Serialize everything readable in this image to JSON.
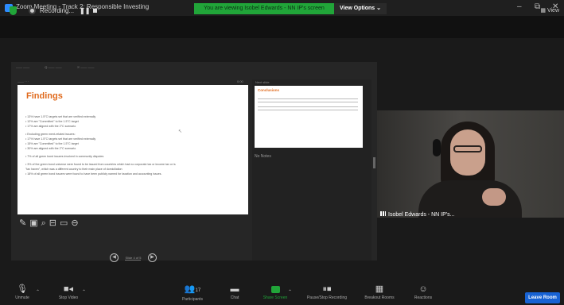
{
  "window": {
    "title": "Zoom Meeting - Track 2: Responsible Investing",
    "share_banner": "You are viewing Isobel Edwards - NN IP's screen",
    "view_options": "View Options ⌄",
    "minimize": "–",
    "restore": "⧉",
    "close": "✕"
  },
  "recording": {
    "label": "Recording...",
    "pause": "❚❚",
    "view_label": "▦ View"
  },
  "share": {
    "toolbar": [
      "—— ——",
      "Q —— ——",
      "☉ —— ——"
    ],
    "strip_left": "—— ·· ·",
    "strip_right": "0:00",
    "notes_header": "Next slide"
  },
  "slide": {
    "title": "Findings",
    "bullets": [
      "• 13% have 1.5°C targets set that are verified externally",
      "• 12% are \"Committed\" to the 1.5°C target",
      "• 17% are aligned with the 2°C scenario",
      "• Excluding green ment-related issuers:",
      "• 17% have 1.5°C targets set that are verified externally",
      "• 15% are \"Committed\" to the 1.5°C target",
      "• 30% are aligned with the 2°C scenario",
      "• 7% of all green bond issuers involved in community disputes",
      "• 3% of the green bond universe were found to be issued from countries which had no corporate tax or income tax or is",
      "  \"tax haven\", which was a different country to their main place of domiciliation",
      "• 18% of all green bond issuers were found to have been publicly named for taxation and accounting issues."
    ]
  },
  "next_slide": {
    "title": "Conclusions"
  },
  "notes": {
    "empty": "No Notes"
  },
  "slide_nav": {
    "prev": "◀",
    "next": "▶",
    "counter": "Slide 4 of 5"
  },
  "video": {
    "name": "Isobel Edwards - NN IP's..."
  },
  "toolbar": {
    "unmute": "Unmute",
    "stop_video": "Stop Video",
    "participants": "Participants",
    "participants_count": "17",
    "chat": "Chat",
    "share_screen": "Share Screen",
    "recording": "Pause/Stop Recording",
    "breakout": "Breakout Rooms",
    "reactions": "Reactions",
    "leave": "Leave Room"
  },
  "colors": {
    "accent_green": "#21a539",
    "leave_blue": "#1762d3",
    "slide_title": "#e06a1d"
  }
}
